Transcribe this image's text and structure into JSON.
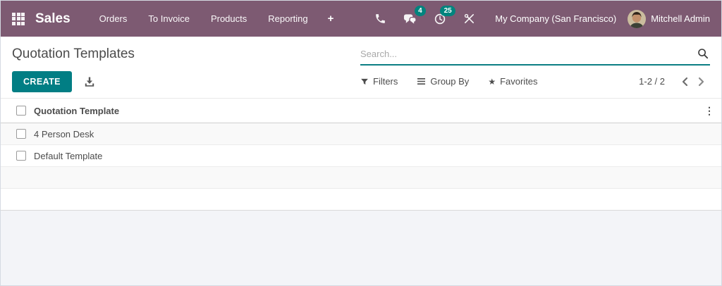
{
  "navbar": {
    "app_name": "Sales",
    "menu_items": [
      "Orders",
      "To Invoice",
      "Products",
      "Reporting"
    ],
    "plus": "+",
    "messages_badge": "4",
    "activities_badge": "25",
    "company": "My Company (San Francisco)",
    "user": "Mitchell Admin"
  },
  "control_panel": {
    "title": "Quotation Templates",
    "create_label": "CREATE",
    "search": {
      "placeholder": "Search..."
    },
    "filters_label": "Filters",
    "group_by_label": "Group By",
    "favorites_label": "Favorites",
    "pager": "1-2 / 2"
  },
  "table": {
    "header": "Quotation Template",
    "rows": [
      "4 Person Desk",
      "Default Template"
    ]
  },
  "icons": {
    "favorites_star": "★",
    "column_dots": "⋮"
  },
  "colors": {
    "navbar_bg": "#7d5a72",
    "accent_teal": "#017e84",
    "badge_teal": "#00847e",
    "page_bg": "#f3f4f8"
  }
}
